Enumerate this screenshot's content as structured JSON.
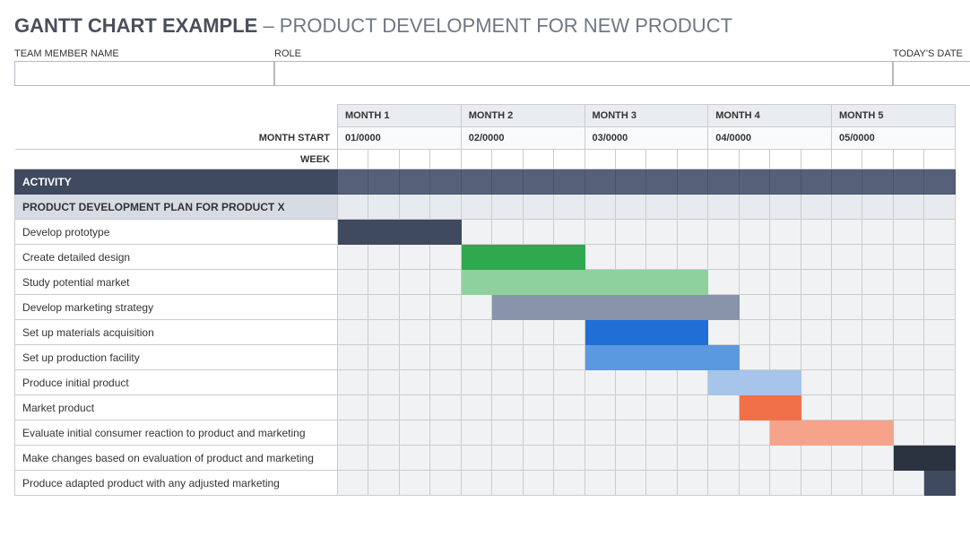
{
  "title_bold": "GANTT CHART EXAMPLE",
  "title_rest": " – PRODUCT DEVELOPMENT FOR NEW PRODUCT",
  "form": {
    "team_label": "TEAM MEMBER NAME",
    "team_value": "",
    "role_label": "ROLE",
    "role_value": "",
    "date_label": "TODAY'S DATE",
    "date_value": ""
  },
  "header_labels": {
    "month_start": "MONTH START",
    "week": "WEEK",
    "activity": "ACTIVITY"
  },
  "months": [
    {
      "name": "MONTH 1",
      "start": "01/0000"
    },
    {
      "name": "MONTH 2",
      "start": "02/0000"
    },
    {
      "name": "MONTH 3",
      "start": "03/0000"
    },
    {
      "name": "MONTH 4",
      "start": "04/0000"
    },
    {
      "name": "MONTH 5",
      "start": "05/0000"
    }
  ],
  "section_title": "PRODUCT DEVELOPMENT PLAN FOR PRODUCT X",
  "tasks": [
    {
      "name": "Develop prototype",
      "start": 0,
      "duration": 4,
      "color": "#3f4a5f"
    },
    {
      "name": "Create detailed design",
      "start": 4,
      "duration": 4,
      "color": "#2fa84f"
    },
    {
      "name": "Study potential market",
      "start": 4,
      "duration": 8,
      "color": "#8fd19e"
    },
    {
      "name": "Develop marketing strategy",
      "start": 5,
      "duration": 8,
      "color": "#8894aa"
    },
    {
      "name": "Set up materials acquisition",
      "start": 8,
      "duration": 4,
      "color": "#1f6fd6"
    },
    {
      "name": "Set up production facility",
      "start": 8,
      "duration": 5,
      "color": "#5a99e0"
    },
    {
      "name": "Produce initial product",
      "start": 12,
      "duration": 3,
      "color": "#a7c4ea"
    },
    {
      "name": "Market product",
      "start": 13,
      "duration": 2,
      "color": "#f0704a"
    },
    {
      "name": "Evaluate initial consumer reaction to product and marketing",
      "start": 14,
      "duration": 4,
      "color": "#f5a38b"
    },
    {
      "name": "Make changes based on evaluation of product and marketing",
      "start": 18,
      "duration": 2,
      "color": "#2b3240"
    },
    {
      "name": "Produce adapted product with any adjusted marketing",
      "start": 19,
      "duration": 1,
      "color": "#3f4a5f"
    }
  ],
  "chart_data": {
    "type": "bar",
    "title": "GANTT CHART EXAMPLE – PRODUCT DEVELOPMENT FOR NEW PRODUCT",
    "xlabel": "WEEK",
    "ylabel": "ACTIVITY",
    "x_range": [
      0,
      20
    ],
    "x_ticks_major": [
      {
        "pos": 0,
        "label": "MONTH 1",
        "sub": "01/0000"
      },
      {
        "pos": 4,
        "label": "MONTH 2",
        "sub": "02/0000"
      },
      {
        "pos": 8,
        "label": "MONTH 3",
        "sub": "03/0000"
      },
      {
        "pos": 12,
        "label": "MONTH 4",
        "sub": "04/0000"
      },
      {
        "pos": 16,
        "label": "MONTH 5",
        "sub": "05/0000"
      }
    ],
    "categories": [
      "Develop prototype",
      "Create detailed design",
      "Study potential market",
      "Develop marketing strategy",
      "Set up materials acquisition",
      "Set up production facility",
      "Produce initial product",
      "Market product",
      "Evaluate initial consumer reaction to product and marketing",
      "Make changes based on evaluation of product and marketing",
      "Produce adapted product with any adjusted marketing"
    ],
    "series": [
      {
        "name": "start_week",
        "values": [
          0,
          4,
          4,
          5,
          8,
          8,
          12,
          13,
          14,
          18,
          19
        ]
      },
      {
        "name": "duration_weeks",
        "values": [
          4,
          4,
          8,
          8,
          4,
          5,
          3,
          2,
          4,
          2,
          1
        ]
      }
    ],
    "colors": [
      "#3f4a5f",
      "#2fa84f",
      "#8fd19e",
      "#8894aa",
      "#1f6fd6",
      "#5a99e0",
      "#a7c4ea",
      "#f0704a",
      "#f5a38b",
      "#2b3240",
      "#3f4a5f"
    ]
  }
}
